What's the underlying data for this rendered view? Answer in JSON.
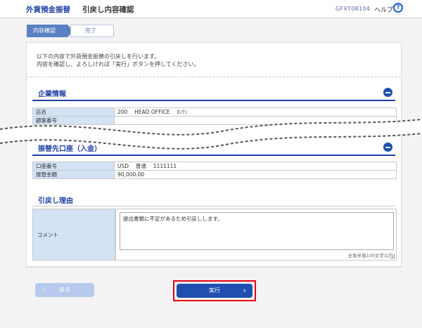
{
  "header": {
    "brand": "外貨預金振替",
    "subtitle": "引戻し内容確認",
    "screen_id": "GFXT08104",
    "help_label": "ヘルプ",
    "help_icon": "?"
  },
  "steps": [
    {
      "label": "内容確認",
      "state": "current"
    },
    {
      "label": "完了",
      "state": "upcoming"
    }
  ],
  "intro": {
    "line1": "以下の内容で外貨預金振替の引戻しを行います。",
    "line2": "内容を確認し、よろしければ「実行」ボタンを押してください。"
  },
  "company_section": {
    "title": "企業情報",
    "rows": [
      {
        "label": "店名",
        "value": "200 　HEAD OFFICE 　ﾎﾝﾃﾝ"
      },
      {
        "label": "顧客番号",
        "value": ""
      }
    ]
  },
  "deposit_section": {
    "title": "振替先口座（入金）",
    "rows": [
      {
        "label": "口座番号",
        "value": "USD 　普通 　1111111"
      },
      {
        "label": "振替金額",
        "value": "90,000.00"
      }
    ]
  },
  "reason_section": {
    "title": "引戻し理由",
    "comment_label": "コメント",
    "comment_value": "提出書類に不足があるため引戻しします。",
    "hint": "全角半角100文字以内"
  },
  "buttons": {
    "back": "戻る",
    "execute": "実行"
  },
  "colors": {
    "brand_blue": "#1f3fa5",
    "button_blue": "#1f4fb0",
    "highlight_red": "#e60012",
    "label_cell_bg": "#d3e2f4"
  }
}
